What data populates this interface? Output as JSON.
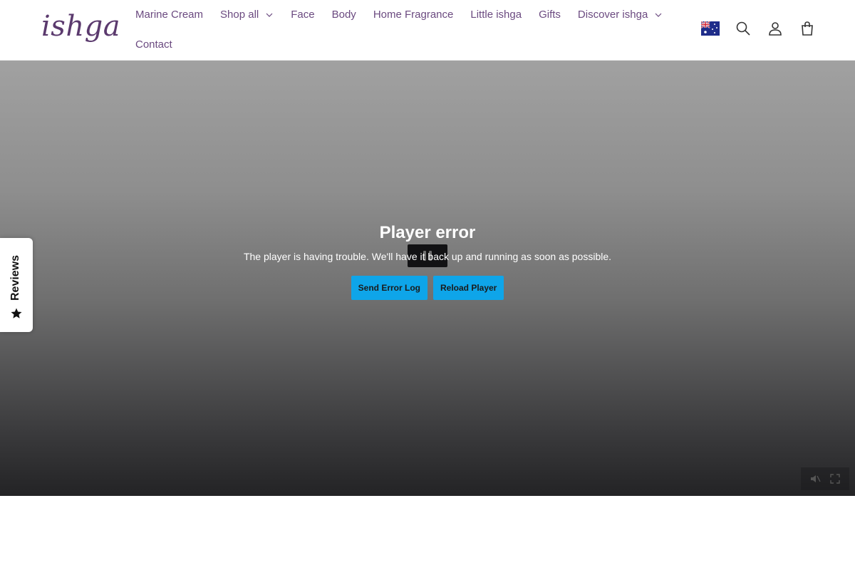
{
  "brand": {
    "logo_text": "ishga",
    "accent": "#5b3a6e"
  },
  "nav": {
    "row1": [
      {
        "label": "Marine Cream",
        "has_dropdown": false
      },
      {
        "label": "Shop all",
        "has_dropdown": true
      },
      {
        "label": "Face",
        "has_dropdown": false
      },
      {
        "label": "Body",
        "has_dropdown": false
      },
      {
        "label": "Home Fragrance",
        "has_dropdown": false
      },
      {
        "label": "Little ishga",
        "has_dropdown": false
      },
      {
        "label": "Gifts",
        "has_dropdown": false
      },
      {
        "label": "Discover ishga",
        "has_dropdown": true
      }
    ],
    "row2": [
      {
        "label": "Contact",
        "has_dropdown": false
      }
    ]
  },
  "header_icons": [
    "australia-flag-icon",
    "search-icon",
    "account-icon",
    "cart-icon"
  ],
  "player": {
    "error_title": "Player error",
    "error_message": "The player is having trouble. We'll have it back up and running as soon as possible.",
    "send_log_label": "Send Error Log",
    "reload_label": "Reload Player",
    "button_color": "#0ea5e9"
  },
  "reviews_tab": {
    "label": "Reviews"
  }
}
